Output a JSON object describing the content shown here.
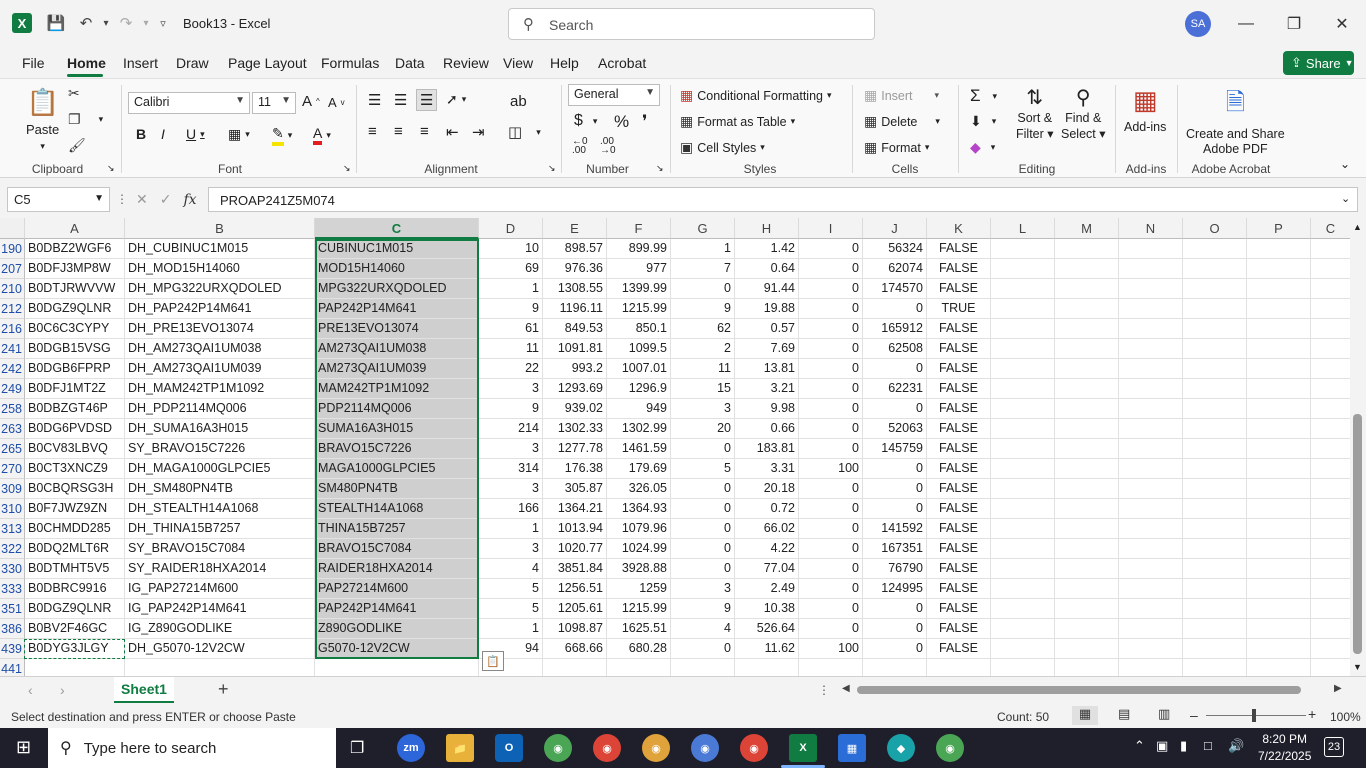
{
  "app": {
    "doc_title": "Book13 - Excel",
    "search_placeholder": "Search",
    "avatar_initials": "SA",
    "accent_color": "#107c41"
  },
  "menu": [
    "File",
    "Home",
    "Insert",
    "Draw",
    "Page Layout",
    "Formulas",
    "Data",
    "Review",
    "View",
    "Help",
    "Acrobat"
  ],
  "share_label": "Share",
  "ribbon": {
    "clipboard": {
      "paste": "Paste",
      "label": "Clipboard"
    },
    "font": {
      "name": "Calibri",
      "size": "11",
      "label": "Font"
    },
    "alignment": {
      "label": "Alignment"
    },
    "number": {
      "format": "General",
      "label": "Number"
    },
    "styles": {
      "conditional": "Conditional Formatting",
      "format_table": "Format as Table",
      "cell_styles": "Cell Styles",
      "label": "Styles"
    },
    "cells": {
      "insert": "Insert",
      "delete": "Delete",
      "format": "Format",
      "label": "Cells"
    },
    "editing": {
      "sort_1": "Sort &",
      "sort_2": "Filter",
      "find_1": "Find &",
      "find_2": "Select",
      "label": "Editing"
    },
    "addins": {
      "button": "Add-ins",
      "label": "Add-ins"
    },
    "acrobat": {
      "line1": "Create and Share",
      "line2": "Adobe PDF",
      "label": "Adobe Acrobat"
    }
  },
  "formula_bar": {
    "name_box": "C5",
    "formula": "PROAP241Z5M074"
  },
  "columns": [
    "A",
    "B",
    "C",
    "D",
    "E",
    "F",
    "G",
    "H",
    "I",
    "J",
    "K",
    "L",
    "M",
    "N",
    "O",
    "P",
    "C"
  ],
  "rows": [
    {
      "n": "190",
      "a": "B0DBZ2WGF6",
      "b": "DH_CUBINUC1M015",
      "c": "CUBINUC1M015",
      "d": "10",
      "e": "898.57",
      "f": "899.99",
      "g": "1",
      "h": "1.42",
      "i": "0",
      "j": "56324",
      "k": "FALSE"
    },
    {
      "n": "207",
      "a": "B0DFJ3MP8W",
      "b": "DH_MOD15H14060",
      "c": "MOD15H14060",
      "d": "69",
      "e": "976.36",
      "f": "977",
      "g": "7",
      "h": "0.64",
      "i": "0",
      "j": "62074",
      "k": "FALSE"
    },
    {
      "n": "210",
      "a": "B0DTJRWVVW",
      "b": "DH_MPG322URXQDOLED",
      "c": "MPG322URXQDOLED",
      "d": "1",
      "e": "1308.55",
      "f": "1399.99",
      "g": "0",
      "h": "91.44",
      "i": "0",
      "j": "174570",
      "k": "FALSE"
    },
    {
      "n": "212",
      "a": "B0DGZ9QLNR",
      "b": "DH_PAP242P14M641",
      "c": "PAP242P14M641",
      "d": "9",
      "e": "1196.11",
      "f": "1215.99",
      "g": "9",
      "h": "19.88",
      "i": "0",
      "j": "0",
      "k": "TRUE"
    },
    {
      "n": "216",
      "a": "B0C6C3CYPY",
      "b": "DH_PRE13EVO13074",
      "c": "PRE13EVO13074",
      "d": "61",
      "e": "849.53",
      "f": "850.1",
      "g": "62",
      "h": "0.57",
      "i": "0",
      "j": "165912",
      "k": "FALSE"
    },
    {
      "n": "241",
      "a": "B0DGB15VSG",
      "b": "DH_AM273QAI1UM038",
      "c": "AM273QAI1UM038",
      "d": "11",
      "e": "1091.81",
      "f": "1099.5",
      "g": "2",
      "h": "7.69",
      "i": "0",
      "j": "62508",
      "k": "FALSE"
    },
    {
      "n": "242",
      "a": "B0DGB6FPRP",
      "b": "DH_AM273QAI1UM039",
      "c": "AM273QAI1UM039",
      "d": "22",
      "e": "993.2",
      "f": "1007.01",
      "g": "11",
      "h": "13.81",
      "i": "0",
      "j": "0",
      "k": "FALSE"
    },
    {
      "n": "249",
      "a": "B0DFJ1MT2Z",
      "b": "DH_MAM242TP1M1092",
      "c": "MAM242TP1M1092",
      "d": "3",
      "e": "1293.69",
      "f": "1296.9",
      "g": "15",
      "h": "3.21",
      "i": "0",
      "j": "62231",
      "k": "FALSE"
    },
    {
      "n": "258",
      "a": "B0DBZGT46P",
      "b": "DH_PDP2114MQ006",
      "c": "PDP2114MQ006",
      "d": "9",
      "e": "939.02",
      "f": "949",
      "g": "3",
      "h": "9.98",
      "i": "0",
      "j": "0",
      "k": "FALSE"
    },
    {
      "n": "263",
      "a": "B0DG6PVDSD",
      "b": "DH_SUMA16A3H015",
      "c": "SUMA16A3H015",
      "d": "214",
      "e": "1302.33",
      "f": "1302.99",
      "g": "20",
      "h": "0.66",
      "i": "0",
      "j": "52063",
      "k": "FALSE"
    },
    {
      "n": "265",
      "a": "B0CV83LBVQ",
      "b": "SY_BRAVO15C7226",
      "c": "BRAVO15C7226",
      "d": "3",
      "e": "1277.78",
      "f": "1461.59",
      "g": "0",
      "h": "183.81",
      "i": "0",
      "j": "145759",
      "k": "FALSE"
    },
    {
      "n": "270",
      "a": "B0CT3XNCZ9",
      "b": "DH_MAGA1000GLPCIE5",
      "c": "MAGA1000GLPCIE5",
      "d": "314",
      "e": "176.38",
      "f": "179.69",
      "g": "5",
      "h": "3.31",
      "i": "100",
      "j": "0",
      "k": "FALSE"
    },
    {
      "n": "309",
      "a": "B0CBQRSG3H",
      "b": "DH_SM480PN4TB",
      "c": "SM480PN4TB",
      "d": "3",
      "e": "305.87",
      "f": "326.05",
      "g": "0",
      "h": "20.18",
      "i": "0",
      "j": "0",
      "k": "FALSE"
    },
    {
      "n": "310",
      "a": "B0F7JWZ9ZN",
      "b": "DH_STEALTH14A1068",
      "c": "STEALTH14A1068",
      "d": "166",
      "e": "1364.21",
      "f": "1364.93",
      "g": "0",
      "h": "0.72",
      "i": "0",
      "j": "0",
      "k": "FALSE"
    },
    {
      "n": "313",
      "a": "B0CHMDD285",
      "b": "DH_THINA15B7257",
      "c": "THINA15B7257",
      "d": "1",
      "e": "1013.94",
      "f": "1079.96",
      "g": "0",
      "h": "66.02",
      "i": "0",
      "j": "141592",
      "k": "FALSE"
    },
    {
      "n": "322",
      "a": "B0DQ2MLT6R",
      "b": "SY_BRAVO15C7084",
      "c": "BRAVO15C7084",
      "d": "3",
      "e": "1020.77",
      "f": "1024.99",
      "g": "0",
      "h": "4.22",
      "i": "0",
      "j": "167351",
      "k": "FALSE"
    },
    {
      "n": "330",
      "a": "B0DTMHT5V5",
      "b": "SY_RAIDER18HXA2014",
      "c": "RAIDER18HXA2014",
      "d": "4",
      "e": "3851.84",
      "f": "3928.88",
      "g": "0",
      "h": "77.04",
      "i": "0",
      "j": "76790",
      "k": "FALSE"
    },
    {
      "n": "333",
      "a": "B0DBRC9916",
      "b": "IG_PAP27214M600",
      "c": "PAP27214M600",
      "d": "5",
      "e": "1256.51",
      "f": "1259",
      "g": "3",
      "h": "2.49",
      "i": "0",
      "j": "124995",
      "k": "FALSE"
    },
    {
      "n": "351",
      "a": "B0DGZ9QLNR",
      "b": "IG_PAP242P14M641",
      "c": "PAP242P14M641",
      "d": "5",
      "e": "1205.61",
      "f": "1215.99",
      "g": "9",
      "h": "10.38",
      "i": "0",
      "j": "0",
      "k": "FALSE"
    },
    {
      "n": "386",
      "a": "B0BV2F46GC",
      "b": "IG_Z890GODLIKE",
      "c": "Z890GODLIKE",
      "d": "1",
      "e": "1098.87",
      "f": "1625.51",
      "g": "4",
      "h": "526.64",
      "i": "0",
      "j": "0",
      "k": "FALSE"
    },
    {
      "n": "439",
      "a": "B0DYG3JLGY",
      "b": "DH_G5070-12V2CW",
      "c": "G5070-12V2CW",
      "d": "94",
      "e": "668.66",
      "f": "680.28",
      "g": "0",
      "h": "11.62",
      "i": "100",
      "j": "0",
      "k": "FALSE"
    },
    {
      "n": "441",
      "a": "",
      "b": "",
      "c": "",
      "d": "",
      "e": "",
      "f": "",
      "g": "",
      "h": "",
      "i": "",
      "j": "",
      "k": ""
    }
  ],
  "sheet_tab": "Sheet1",
  "status": {
    "message": "Select destination and press ENTER or choose Paste",
    "count": "Count: 50",
    "zoom": "100%"
  },
  "taskbar": {
    "search_placeholder": "Type here to search",
    "time": "8:20 PM",
    "date": "7/22/2025",
    "notifications": "23"
  }
}
